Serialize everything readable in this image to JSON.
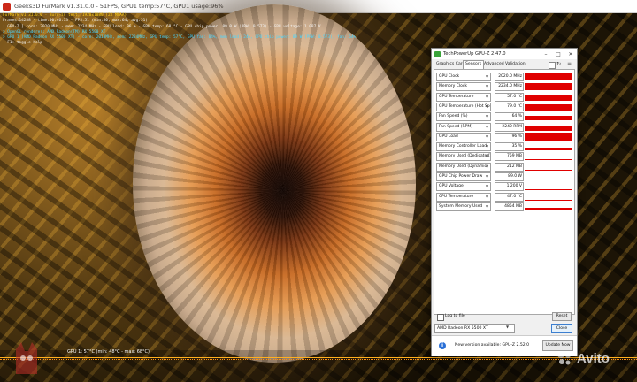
{
  "window": {
    "title": "Geeks3D FurMark v1.31.0.0 - 51FPS, GPU1 temp:57°C, GPU1 usage:96%"
  },
  "osd": {
    "lines": [
      {
        "text": "FurMark v1.31.0.0 - Burn-in test, 1920x1080 (2X MSAA)",
        "color": "yellow"
      },
      {
        "text": "Frames:14288 - time:00:46:33 - FPS:51 (min:50, max:64, avg:51)",
        "color": "white"
      },
      {
        "text": "[ GPU-Z ] core: 2020 MHz - mem: 2234 MHz - GPU load: 96 % - GPU temp: 68 °C - GPU chip power: 89.0 W (PPW: 0.573) - GPU voltage: 1.087 V",
        "color": "white"
      },
      {
        "text": "> OpenGL renderer: AMD Radeon(TM) RX 5500 XT",
        "color": "cyan"
      },
      {
        "text": "> GPU 1 (AMD Radeon RX 5500 XT) - core: 2013MHz, mem: 2234MHz, GPU temp: 57°C, GPU fan: 64%, mem load: 24%, GPU chip power: 89 W (PPW: 0.573), fan: 64%",
        "color": "cyan"
      },
      {
        "text": "- F1: toggle help",
        "color": "white"
      }
    ]
  },
  "graph": {
    "label": "GPU 1: 57°C (min: 48°C - max: 68°C)"
  },
  "watermark": {
    "text": "Avito"
  },
  "gpuz": {
    "title": "TechPowerUp GPU-Z 2.47.0",
    "controls": {
      "minimize": "–",
      "maximize": "□",
      "close": "✕"
    },
    "tabs": [
      "Graphics Card",
      "Sensors",
      "Advanced",
      "Validation"
    ],
    "active_tab": "Sensors",
    "sensors": [
      {
        "name": "GPU Clock",
        "value": "2020.0 MHz",
        "level": 0.9
      },
      {
        "name": "Memory Clock",
        "value": "2234.0 MHz",
        "level": 0.92
      },
      {
        "name": "GPU Temperature",
        "value": "57.0 °C",
        "level": 0.7
      },
      {
        "name": "GPU Temperature (Hot Spot)",
        "value": "79.0 °C",
        "level": 0.8
      },
      {
        "name": "Fan Speed (%)",
        "value": "64 %",
        "level": 0.6
      },
      {
        "name": "Fan Speed (RPM)",
        "value": "2240 RPM",
        "level": 0.65
      },
      {
        "name": "GPU Load",
        "value": "96 %",
        "level": 0.96
      },
      {
        "name": "Memory Controller Load",
        "value": "35 %",
        "level": 0.35
      },
      {
        "name": "Memory Used (Dedicated)",
        "value": "759 MB",
        "level": 0.12
      },
      {
        "name": "Memory Used (Dynamic)",
        "value": "212 MB",
        "level": 0.08
      },
      {
        "name": "GPU Chip Power Draw",
        "value": "89.0 W",
        "level": 0.1
      },
      {
        "name": "GPU Voltage",
        "value": "1.200 V",
        "level": 0.15
      },
      {
        "name": "CPU Temperature",
        "value": "47.0 °C",
        "level": 0.12
      },
      {
        "name": "System Memory Used",
        "value": "4854 MB",
        "level": 0.3
      }
    ],
    "log_to_file": "Log to file",
    "reset": "Reset",
    "gpu_select": "AMD Radeon RX 5500 XT",
    "close": "Close",
    "update_text": "New version available: GPU-Z 2.52.0",
    "update_button": "Update Now",
    "graph_color": "#e00000"
  }
}
